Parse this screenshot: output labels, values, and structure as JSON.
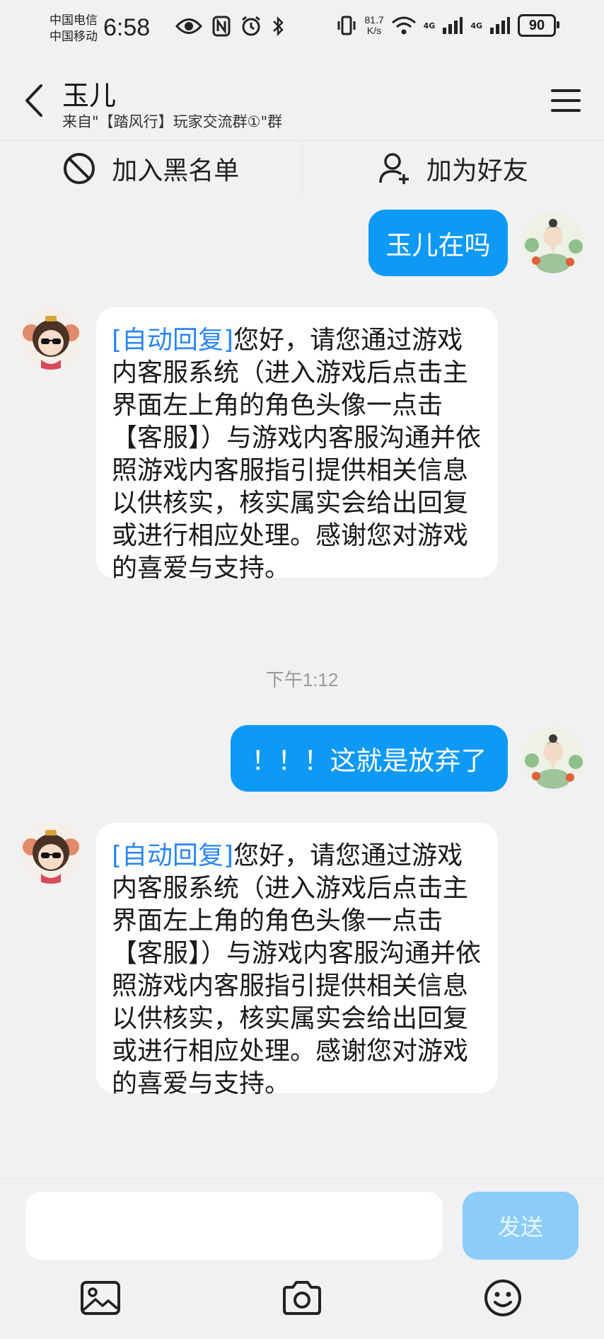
{
  "status_bar": {
    "carrier_1": "中国电信",
    "carrier_2": "中国移动",
    "time": "6:58",
    "speed_value": "81.7",
    "speed_unit": "K/s",
    "net_1": "4G",
    "net_2": "4G",
    "battery": "90"
  },
  "header": {
    "name": "玉儿",
    "source": "来自\"【踏风行】玩家交流群①\"群"
  },
  "actions": {
    "blacklist_label": "加入黑名单",
    "add_friend_label": "加为好友"
  },
  "messages": [
    {
      "direction": "out",
      "text": "玉儿在吗"
    },
    {
      "direction": "in",
      "tag": "[自动回复]",
      "text": "您好，请您通过游戏内客服系统（进入游戏后点击主界面左上角的角色头像一点击【客服】）与游戏内客服沟通并依照游戏内客服指引提供相关信息以供核实，核实属实会给出回复或进行相应处理。感谢您对游戏的喜爱与支持。"
    },
    {
      "direction": "out",
      "text": "！！！这就是放弃了"
    },
    {
      "direction": "in",
      "tag": "[自动回复]",
      "text": "您好，请您通过游戏内客服系统（进入游戏后点击主界面左上角的角色头像一点击【客服】）与游戏内客服沟通并依照游戏内客服指引提供相关信息以供核实，核实属实会给出回复或进行相应处理。感谢您对游戏的喜爱与支持。"
    }
  ],
  "timestamp": "下午1:12",
  "input": {
    "placeholder": "",
    "send_label": "发送"
  },
  "toolbar": [
    "image-icon",
    "camera-icon",
    "emoji-icon"
  ],
  "colors": {
    "accent": "#0e99f5",
    "send_disabled": "#8bcdf8",
    "auto_tag": "#2a86f0",
    "background": "#f1f1f3"
  }
}
